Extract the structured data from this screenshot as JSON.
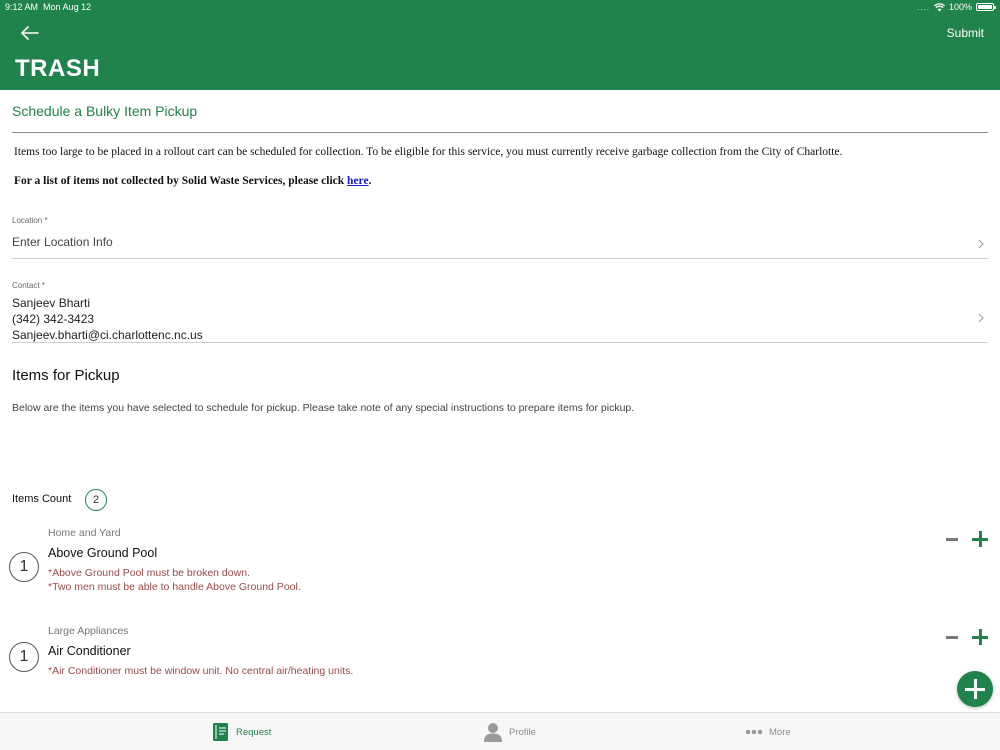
{
  "status_bar": {
    "time": "9:12 AM",
    "date": "Mon Aug 12",
    "signal": "....",
    "battery": "100%"
  },
  "header": {
    "title": "TRASH",
    "submit_label": "Submit"
  },
  "page": {
    "title": "Schedule a Bulky Item Pickup",
    "intro": "Items too large to be placed in a rollout cart can be scheduled for collection. To be eligible for this service, you must currently receive garbage collection from the City of Charlotte.",
    "intro_bold_prefix": "For a list of items not collected by Solid Waste Services, please click ",
    "intro_link": "here",
    "intro_bold_suffix": "."
  },
  "location": {
    "label": "Location *",
    "placeholder": "Enter Location Info"
  },
  "contact": {
    "label": "Contact *",
    "name": "Sanjeev Bharti",
    "phone": "(342) 342-3423",
    "email": "Sanjeev.bharti@ci.charlottenc.nc.us"
  },
  "items_section": {
    "title": "Items for Pickup",
    "description": "Below are the items you have selected to schedule for pickup. Please take note of any special instructions to prepare items for pickup.",
    "count_label": "Items Count",
    "count": "2"
  },
  "items": [
    {
      "category": "Home and Yard",
      "name": "Above Ground Pool",
      "quantity": "1",
      "notes": [
        "*Above Ground Pool must be broken down.",
        "*Two men must be able to handle Above Ground Pool."
      ]
    },
    {
      "category": "Large Appliances",
      "name": "Air Conditioner",
      "quantity": "1",
      "notes": [
        "*Air Conditioner must be window unit.  No central air/heating units."
      ]
    }
  ],
  "tabs": [
    {
      "label": "Request",
      "icon": "book-icon",
      "active": true
    },
    {
      "label": "Profile",
      "icon": "person-icon",
      "active": false
    },
    {
      "label": "More",
      "icon": "more-dots-icon",
      "active": false
    }
  ],
  "colors": {
    "brand_green": "#20834c",
    "note_red": "#9b4a4a",
    "link_blue": "#1a1ad6"
  }
}
